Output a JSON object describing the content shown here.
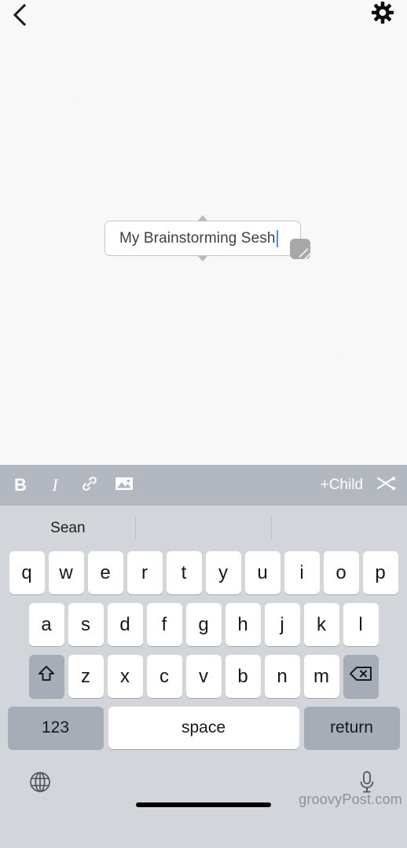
{
  "app": {
    "canvas_bg": "#f8f8f8",
    "accent_caret": "#4a90ff",
    "toolbar_bg": "#b3b7c0",
    "keyboard_bg": "#d2d5da"
  },
  "topbar": {
    "back_icon": "chevron-left-icon",
    "settings_icon": "gear-icon"
  },
  "node": {
    "text": "My Brainstorming Sesh",
    "caret_visible": true,
    "resize_handle_icon": "resize-grip-icon",
    "connector_top_icon": "triangle-up-icon",
    "connector_bottom_icon": "triangle-down-icon"
  },
  "format_toolbar": {
    "bold_label": "B",
    "italic_label": "I",
    "link_icon": "link-icon",
    "image_icon": "image-icon",
    "add_child_label": "+Child",
    "cut_icon": "scissors-icon"
  },
  "keyboard": {
    "predictions": [
      "Sean",
      "",
      ""
    ],
    "row1": [
      "q",
      "w",
      "e",
      "r",
      "t",
      "y",
      "u",
      "i",
      "o",
      "p"
    ],
    "row2": [
      "a",
      "s",
      "d",
      "f",
      "g",
      "h",
      "j",
      "k",
      "l"
    ],
    "row3": [
      "z",
      "x",
      "c",
      "v",
      "b",
      "n",
      "m"
    ],
    "shift_icon": "shift-arrow-icon",
    "backspace_icon": "backspace-delete-icon",
    "numeric_label": "123",
    "space_label": "space",
    "return_label": "return",
    "globe_icon": "globe-icon",
    "mic_icon": "microphone-icon"
  },
  "watermark": {
    "text": "groovyPost.com"
  }
}
